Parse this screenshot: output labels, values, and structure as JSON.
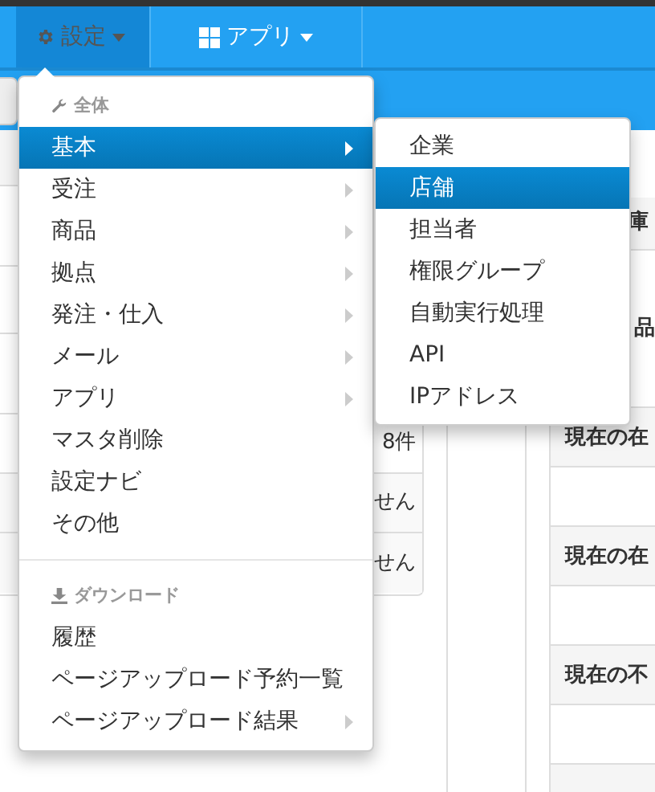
{
  "navbar": {
    "items": [
      {
        "label": "設定",
        "selected": true
      },
      {
        "label": "アプリ",
        "selected": false
      }
    ]
  },
  "left_panel": {
    "rows": [
      "8件",
      "せん",
      "せん"
    ]
  },
  "right_panel": {
    "header": "庫",
    "first_row": "品",
    "labels": [
      "現在の在",
      "現在の在",
      "現在の不"
    ]
  },
  "settings_menu": {
    "sections": [
      {
        "header": "全体",
        "items": [
          {
            "label": "基本",
            "has_submenu": true,
            "selected": true
          },
          {
            "label": "受注",
            "has_submenu": true,
            "selected": false
          },
          {
            "label": "商品",
            "has_submenu": true,
            "selected": false
          },
          {
            "label": "拠点",
            "has_submenu": true,
            "selected": false
          },
          {
            "label": "発注・仕入",
            "has_submenu": true,
            "selected": false
          },
          {
            "label": "メール",
            "has_submenu": true,
            "selected": false
          },
          {
            "label": "アプリ",
            "has_submenu": true,
            "selected": false
          },
          {
            "label": "マスタ削除",
            "has_submenu": false,
            "selected": false
          },
          {
            "label": "設定ナビ",
            "has_submenu": false,
            "selected": false
          },
          {
            "label": "その他",
            "has_submenu": false,
            "selected": false
          }
        ]
      },
      {
        "header": "ダウンロード",
        "items": [
          {
            "label": "履歴",
            "has_submenu": false,
            "selected": false
          },
          {
            "label": "ページアップロード予約一覧",
            "has_submenu": false,
            "selected": false
          },
          {
            "label": "ページアップロード結果",
            "has_submenu": true,
            "selected": false
          }
        ]
      }
    ]
  },
  "submenu": {
    "items": [
      {
        "label": "企業",
        "selected": false
      },
      {
        "label": "店舗",
        "selected": true
      },
      {
        "label": "担当者",
        "selected": false
      },
      {
        "label": "権限グループ",
        "selected": false
      },
      {
        "label": "自動実行処理",
        "selected": false
      },
      {
        "label": "API",
        "selected": false
      },
      {
        "label": "IPアドレス",
        "selected": false
      }
    ]
  }
}
